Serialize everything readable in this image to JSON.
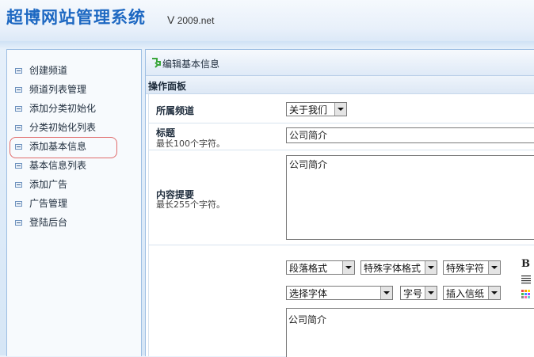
{
  "header": {
    "title": "超博网站管理系统",
    "version_prefix": "V",
    "version": "2009.net"
  },
  "sidebar": {
    "items": [
      {
        "label": "创建频道"
      },
      {
        "label": "频道列表管理"
      },
      {
        "label": "添加分类初始化"
      },
      {
        "label": "分类初始化列表"
      },
      {
        "label": "添加基本信息"
      },
      {
        "label": "基本信息列表"
      },
      {
        "label": "添加广告"
      },
      {
        "label": "广告管理"
      },
      {
        "label": "登陆后台"
      }
    ],
    "selected_label": "添加基本信息"
  },
  "content": {
    "page_title": "编辑基本信息",
    "panel_title": "操作面板",
    "channel": {
      "label": "所属频道",
      "selected": "关于我们"
    },
    "title_field": {
      "label": "标题",
      "hint": "最长100个字符。",
      "value": "公司简介"
    },
    "summary_field": {
      "label": "内容提要",
      "hint": "最长255个字符。",
      "value": "公司简介"
    },
    "editor": {
      "paragraph_format": "段落格式",
      "special_font_format": "特殊字体格式",
      "special_char": "特殊字符",
      "font_select": "选择字体",
      "font_size": "字号",
      "insert_stationery": "插入信纸",
      "bold_label": "B",
      "content": "公司简介"
    }
  },
  "colors": {
    "title_blue": "#1d68c2",
    "highlight_red": "#e06b6b",
    "border_blue": "#9ebfe3"
  }
}
